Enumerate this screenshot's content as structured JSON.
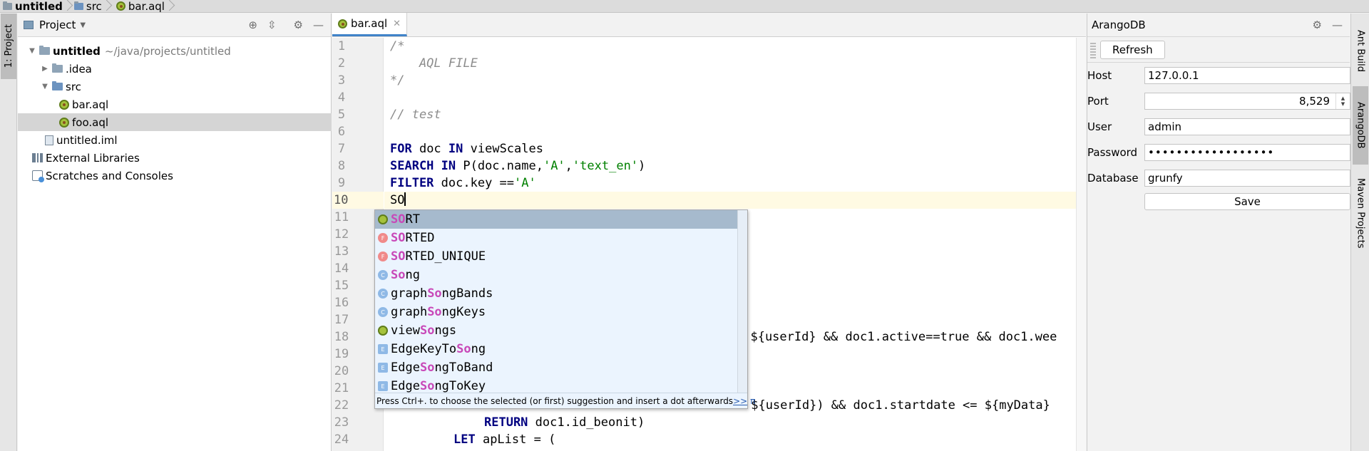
{
  "breadcrumb": [
    "untitled",
    "src",
    "bar.aql"
  ],
  "left_stripe": {
    "project_tab": "1: Project"
  },
  "project_panel": {
    "title": "Project",
    "tree": [
      {
        "label": "untitled",
        "path": "~/java/projects/untitled"
      },
      {
        "label": ".idea"
      },
      {
        "label": "src"
      },
      {
        "label": "bar.aql"
      },
      {
        "label": "foo.aql"
      },
      {
        "label": "untitled.iml"
      },
      {
        "label": "External Libraries"
      },
      {
        "label": "Scratches and Consoles"
      }
    ]
  },
  "editor": {
    "tab_label": "bar.aql",
    "line_numbers": [
      "1",
      "2",
      "3",
      "4",
      "5",
      "6",
      "7",
      "8",
      "9",
      "10",
      "11",
      "12",
      "13",
      "14",
      "15",
      "16",
      "17",
      "18",
      "19",
      "20",
      "21",
      "22",
      "23",
      "24"
    ],
    "lines": {
      "l1": "/*",
      "l2": "    AQL FILE",
      "l3": "*/",
      "l5": "// test",
      "l7_kw1": "FOR",
      "l7_a": " doc ",
      "l7_kw2": "IN",
      "l7_b": " viewScales",
      "l8_kw": "SEARCH IN",
      "l8_a": " P(doc.name,",
      "l8_s1": "'A'",
      "l8_b": ",",
      "l8_s2": "'text_en'",
      "l8_c": ")",
      "l9_kw": "FILTER",
      "l9_a": " doc.key ==",
      "l9_s": "'A'",
      "l10": "SO",
      "l18": "= ${userId} && doc1.active==true && doc1.wee",
      "l22": "                  ${userId}) && doc1.startdate <= ${myData}",
      "l23_kw": "RETURN",
      "l23_a": " doc1.id_beonit)",
      "l24_kw": "LET",
      "l24_a": " apList = ("
    }
  },
  "completion": {
    "items": [
      {
        "pre": "",
        "match": "SO",
        "post": "RT",
        "icon": "keyword"
      },
      {
        "pre": "",
        "match": "SO",
        "post": "RTED",
        "icon": "function",
        "badge": "F"
      },
      {
        "pre": "",
        "match": "SO",
        "post": "RTED_UNIQUE",
        "icon": "function",
        "badge": "F"
      },
      {
        "pre": "",
        "match": "So",
        "post": "ng",
        "icon": "class",
        "badge": "C"
      },
      {
        "pre": "graph",
        "match": "So",
        "post": "ngBands",
        "icon": "class",
        "badge": "C"
      },
      {
        "pre": "graph",
        "match": "So",
        "post": "ngKeys",
        "icon": "class",
        "badge": "C"
      },
      {
        "pre": "view",
        "match": "So",
        "post": "ngs",
        "icon": "keyword"
      },
      {
        "pre": "EdgeKeyTo",
        "match": "So",
        "post": "ng",
        "icon": "edge",
        "badge": "E"
      },
      {
        "pre": "Edge",
        "match": "So",
        "post": "ngToBand",
        "icon": "edge",
        "badge": "E"
      },
      {
        "pre": "Edge",
        "match": "So",
        "post": "ngToKey",
        "icon": "edge",
        "badge": "E"
      }
    ],
    "footer": "Press Ctrl+. to choose the selected (or first) suggestion and insert a dot afterwards",
    "footer_link": ">>",
    "footer_pi": "π"
  },
  "arango": {
    "title": "ArangoDB",
    "refresh": "Refresh",
    "host_label": "Host",
    "host": "127.0.0.1",
    "port_label": "Port",
    "port": "8,529",
    "user_label": "User",
    "user": "admin",
    "password_label": "Password",
    "password": "••••••••••••••••••",
    "database_label": "Database",
    "database": "grunfy",
    "save": "Save"
  },
  "right_stripe": {
    "ant": "Ant Build",
    "arango": "ArangoDB",
    "maven": "Maven Projects"
  }
}
